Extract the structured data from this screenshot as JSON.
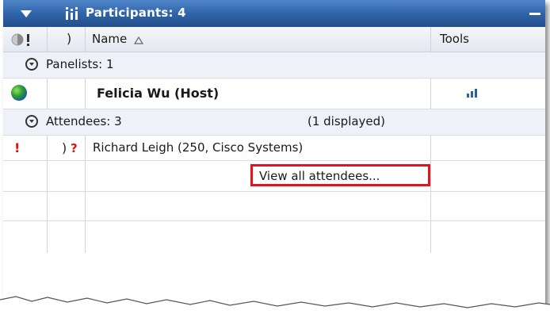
{
  "panel": {
    "title": "Participants: 4"
  },
  "columns": {
    "name_label": "Name",
    "tools_label": "Tools",
    "audio_glyph": ")"
  },
  "groups": {
    "panelists_label": "Panelists: 1",
    "attendees_label": "Attendees: 3",
    "attendees_displayed": "(1 displayed)"
  },
  "host": {
    "name": "Felicia  Wu (Host)"
  },
  "attendee": {
    "flag": "!",
    "audio": ")",
    "question": "?",
    "name": "Richard Leigh (250, Cisco Systems)"
  },
  "view_all_label": "View all attendees...",
  "colors": {
    "titlebar": "#2e62a6",
    "highlight_border": "#e0141e",
    "alert_red": "#e01010"
  },
  "icons": {
    "collapse": "triangle-down-icon",
    "participants": "participants-icon",
    "minimize": "minimize-icon",
    "status": "status-alert-icon",
    "audio": "audio-icon",
    "sort": "sort-ascending-icon",
    "group_toggle": "circle-chevron-down-icon",
    "host_status": "globe-icon",
    "tools": "signal-bars-icon"
  }
}
